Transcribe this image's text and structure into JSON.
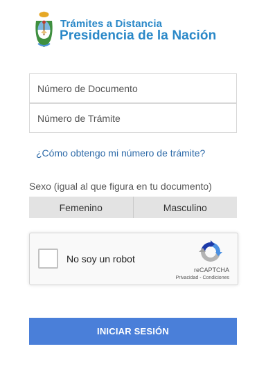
{
  "header": {
    "line1": "Trámites a Distancia",
    "line2": "Presidencia de la Nación",
    "emblem_icon": "argentina-coat-of-arms-icon"
  },
  "form": {
    "documento_placeholder": "Número de Documento",
    "documento_value": "",
    "tramite_placeholder": "Número de Trámite",
    "tramite_value": "",
    "help_link": "¿Cómo obtengo mi número de trámite?",
    "sexo_label": "Sexo (igual al que figura en tu documento)",
    "sexo_options": [
      "Femenino",
      "Masculino"
    ],
    "submit_label": "INICIAR SESIÓN"
  },
  "recaptcha": {
    "label": "No soy un robot",
    "brand": "reCAPTCHA",
    "terms": "Privacidad - Condiciones",
    "logo_icon": "recaptcha-logo-icon"
  },
  "colors": {
    "brand": "#2a88c8",
    "link": "#2d6aa8",
    "button": "#4a7fd9",
    "toggle_bg": "#e3e3e3"
  }
}
